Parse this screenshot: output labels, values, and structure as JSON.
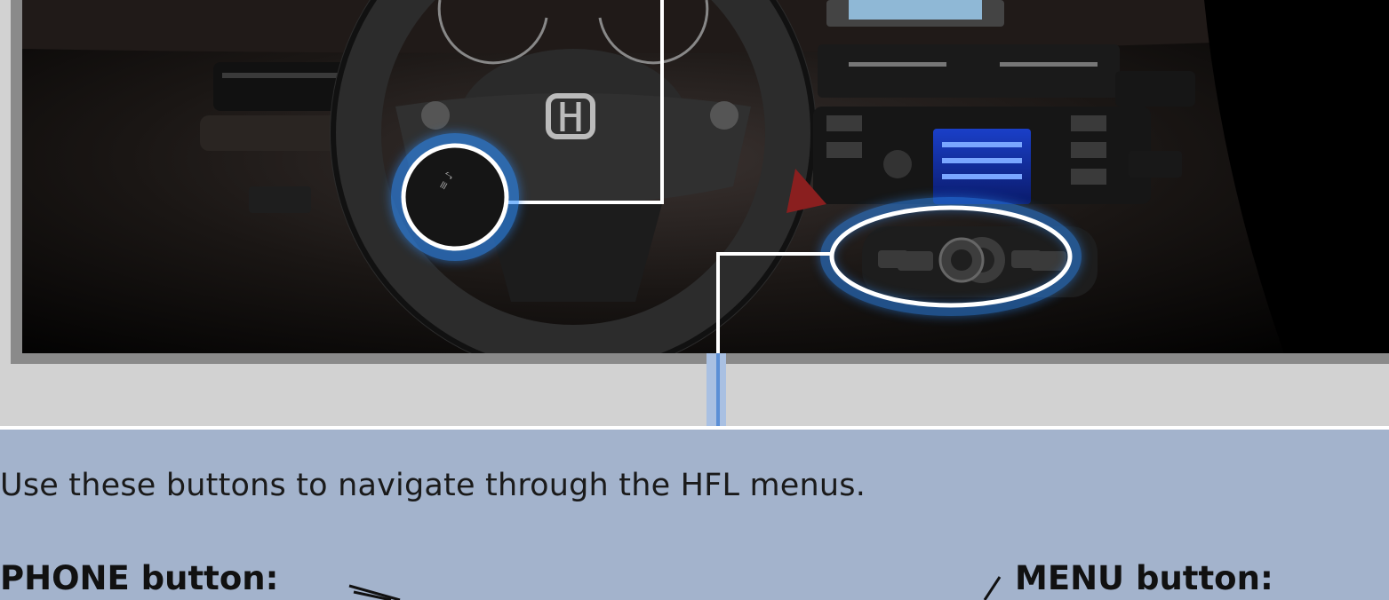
{
  "intro": "Use these buttons to navigate through the HFL menus.",
  "labels": {
    "phone": "PHONE button:",
    "menu": "MENU button:"
  },
  "colors": {
    "panel": "#a3b3cc",
    "highlight": "#2f8fff",
    "frame": "#8a8a8a"
  }
}
